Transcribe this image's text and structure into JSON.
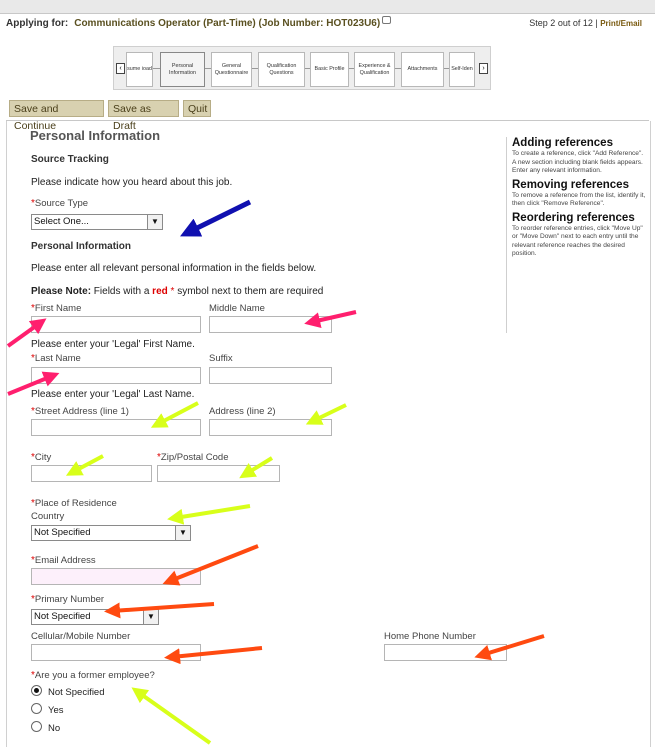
{
  "header": {
    "applying_label": "Applying for:",
    "job_title": "Communications Operator (Part-Time) (Job Number: HOT023U6)",
    "step_info": "Step 2 out of 12 |",
    "print_link": "Print/Email"
  },
  "stepper": {
    "steps": [
      "sume ioad",
      "Personal Information",
      "General Questionnaire",
      "Qualification Questions",
      "Basic Profile",
      "Experience & Qualification",
      "Attachments",
      "Self-Iden"
    ],
    "active_index": 1
  },
  "buttons": {
    "save_continue": "Save and Continue",
    "save_draft": "Save as Draft",
    "quit": "Quit"
  },
  "form": {
    "title": "Personal Information",
    "source_tracking": "Source Tracking",
    "source_intro": "Please indicate how you heard about this job.",
    "source_type_label": "Source Type",
    "source_type_value": "Select One...",
    "personal_info_sub": "Personal Information",
    "personal_intro": "Please enter all relevant personal information in the fields below.",
    "note_prefix": "Please Note:",
    "note_mid": " Fields with a ",
    "note_red": "red",
    "note_star": " * ",
    "note_suffix": "symbol next to them are required",
    "required_mark": "*",
    "first_name_label": "First Name",
    "middle_name_label": "Middle Name",
    "first_name_hint": "Please enter your 'Legal' First Name.",
    "last_name_label": "Last Name",
    "suffix_label": "Suffix",
    "last_name_hint": "Please enter your 'Legal' Last Name.",
    "street1_label": "Street Address (line 1)",
    "address2_label": "Address (line 2)",
    "city_label": "City",
    "zip_label": "Zip/Postal Code",
    "residence_label": "Place of Residence",
    "country_label": "Country",
    "country_value": "Not Specified",
    "email_label": "Email Address",
    "primary_number_label": "Primary Number",
    "primary_number_value": "Not Specified",
    "cell_label": "Cellular/Mobile Number",
    "home_phone_label": "Home Phone Number",
    "former_employee_label": "Are you a former employee?",
    "former_options": [
      "Not Specified",
      "Yes",
      "No"
    ],
    "former_selected": 0
  },
  "help": {
    "adding_title": "Adding references",
    "adding_text": "To create a reference, click \"Add Reference\". A new section including blank fields appears. Enter any relevant information.",
    "removing_title": "Removing references",
    "removing_text": "To remove a reference from the list, identify it, then click \"Remove Reference\".",
    "reordering_title": "Reordering references",
    "reordering_text": "To reorder reference entries, click \"Move Up\" or \"Move Down\" next to each entry until the relevant reference reaches the desired position."
  },
  "colors": {
    "arrow_blue": "#1010b0",
    "arrow_pink": "#ff1f6e",
    "arrow_yellow": "#d8ff1a",
    "arrow_orange": "#ff4a10",
    "required_red": "#dd0000",
    "button_bg": "#d8d1b0"
  }
}
